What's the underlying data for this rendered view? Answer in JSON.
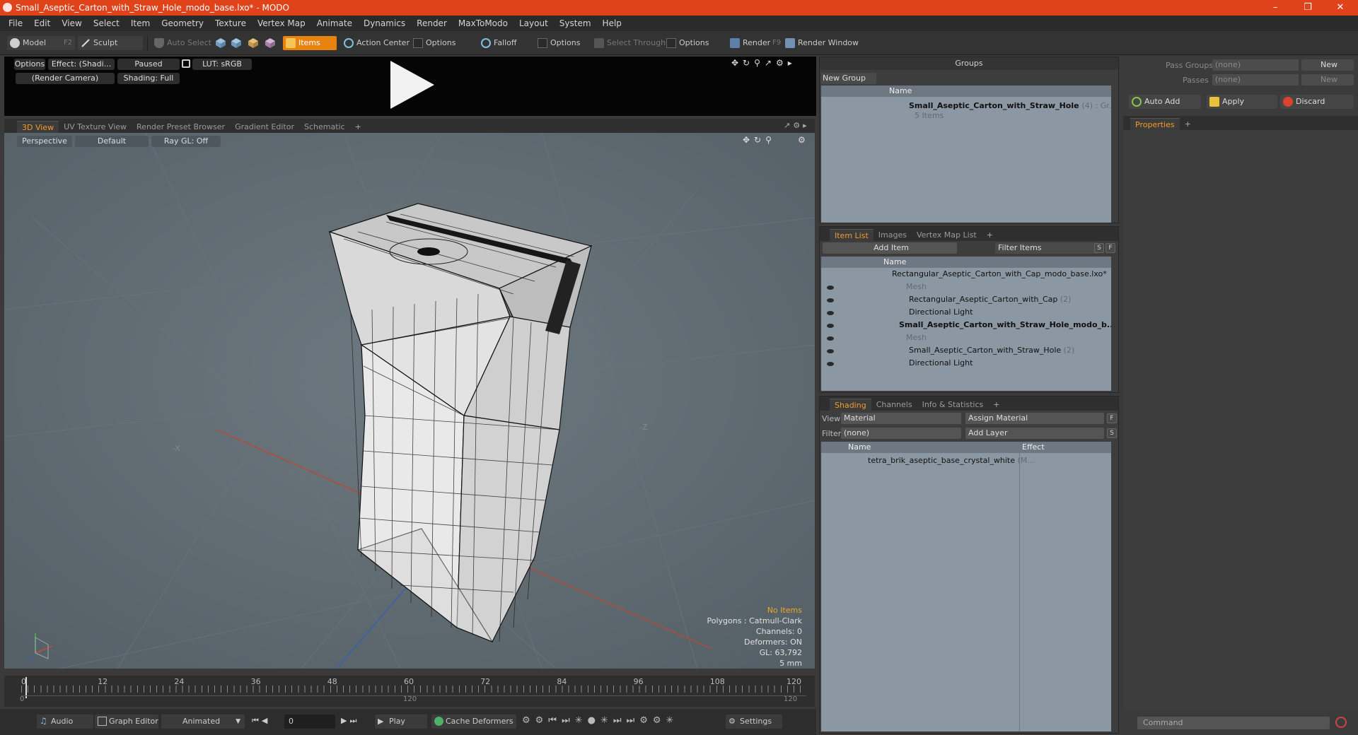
{
  "title": {
    "window_title": "Small_Aseptic_Carton_with_Straw_Hole_modo_base.lxo* - MODO"
  },
  "menu": [
    "File",
    "Edit",
    "View",
    "Select",
    "Item",
    "Geometry",
    "Texture",
    "Vertex Map",
    "Animate",
    "Dynamics",
    "Render",
    "MaxToModo",
    "Layout",
    "System",
    "Help"
  ],
  "toolbar": {
    "model": "Model",
    "model_key": "F2",
    "sculpt": "Sculpt",
    "auto_select": "Auto Select",
    "items": "Items",
    "action_center": "Action Center",
    "options": "Options",
    "falloff": "Falloff",
    "select_through": "Select Through",
    "render": "Render",
    "render_key": "F9",
    "render_window": "Render Window"
  },
  "preview": {
    "options": "Options",
    "effect": "Effect: (Shadi...",
    "paused": "Paused",
    "lut": "LUT: sRGB",
    "camera": "(Render Camera)",
    "shading": "Shading: Full"
  },
  "viewtabs": [
    "3D View",
    "UV Texture View",
    "Render Preset Browser",
    "Gradient Editor",
    "Schematic",
    "+"
  ],
  "viewport": {
    "projection": "Perspective",
    "style": "Default",
    "raygl": "Ray GL: Off",
    "axis_x": "-X",
    "axis_z": "-Z",
    "hud": [
      "No Items",
      "Polygons : Catmull-Clark",
      "Channels: 0",
      "Deformers: ON",
      "GL: 63,792",
      "5 mm"
    ]
  },
  "timeline": {
    "ticks": [
      "0",
      "12",
      "24",
      "36",
      "48",
      "60",
      "72",
      "84",
      "96",
      "108",
      "120"
    ],
    "lower": [
      "0",
      "120",
      "120"
    ]
  },
  "bottom": {
    "audio": "Audio",
    "graph_editor": "Graph Editor",
    "animated": "Animated",
    "frame": "0",
    "play": "Play",
    "cache": "Cache Deformers",
    "settings": "Settings"
  },
  "groups": {
    "title": "Groups",
    "new_group": "New Group",
    "col_name": "Name",
    "item_name": "Small_Aseptic_Carton_with_Straw_Hole",
    "item_suffix": "(4) : Gr...",
    "item_sub": "5 Items"
  },
  "itemlist": {
    "tabs": [
      "Item List",
      "Images",
      "Vertex Map List",
      "+"
    ],
    "add_item": "Add Item",
    "filter": "Filter Items",
    "s": "S",
    "f": "F",
    "col_name": "Name",
    "rows": [
      {
        "text": "Rectangular_Aseptic_Carton_with_Cap_modo_base.lxo*",
        "count": ""
      },
      {
        "text": "Mesh",
        "count": ""
      },
      {
        "text": "Rectangular_Aseptic_Carton_with_Cap",
        "count": "(2)"
      },
      {
        "text": "Directional Light",
        "count": ""
      },
      {
        "text": "Small_Aseptic_Carton_with_Straw_Hole_modo_b...",
        "count": ""
      },
      {
        "text": "Mesh",
        "count": ""
      },
      {
        "text": "Small_Aseptic_Carton_with_Straw_Hole",
        "count": "(2)"
      },
      {
        "text": "Directional Light",
        "count": ""
      }
    ]
  },
  "shading": {
    "tabs": [
      "Shading",
      "Channels",
      "Info & Statistics",
      "+"
    ],
    "view_label": "View",
    "view_value": "Material",
    "assign": "Assign Material",
    "f": "F",
    "filter_label": "Filter",
    "filter_value": "(none)",
    "add_layer": "Add Layer",
    "s": "S",
    "col_name": "Name",
    "col_effect": "Effect",
    "row": "tetra_brik_aseptic_base_crystal_white",
    "row_suffix": "(M..."
  },
  "right": {
    "pass_groups": "Pass Groups",
    "passes": "Passes",
    "none": "(none)",
    "new": "New",
    "auto_add": "Auto Add",
    "apply": "Apply",
    "discard": "Discard",
    "properties": "Properties",
    "command": "Command"
  }
}
